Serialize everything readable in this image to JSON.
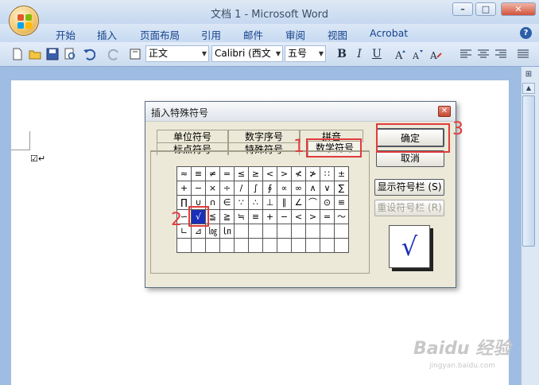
{
  "window": {
    "title": "文档 1 - Microsoft Word",
    "minimize": "–",
    "maximize": "□",
    "close": "✕"
  },
  "menu": {
    "items": [
      "开始",
      "插入",
      "页面布局",
      "引用",
      "邮件",
      "审阅",
      "视图",
      "Acrobat"
    ],
    "help": "?"
  },
  "toolbar": {
    "style": "正文",
    "font": "Calibri (西文",
    "size": "五号",
    "bold": "B",
    "italic": "I",
    "underline": "U"
  },
  "document": {
    "text": "☑↵"
  },
  "dialog": {
    "title": "插入特殊符号",
    "close": "✕",
    "tabs_back": [
      "单位符号",
      "数字序号",
      "拼音"
    ],
    "tabs_front": [
      "标点符号",
      "特殊符号",
      "数学符号"
    ],
    "grid": [
      [
        "≈",
        "≡",
        "≠",
        "=",
        "≤",
        "≥",
        "<",
        ">",
        "≮",
        "≯",
        "∷",
        "±"
      ],
      [
        "+",
        "−",
        "×",
        "÷",
        "/",
        "∫",
        "∮",
        "∝",
        "∞",
        "∧",
        "∨",
        "∑"
      ],
      [
        "∏",
        "∪",
        "∩",
        "∈",
        "∵",
        "∴",
        "⊥",
        "∥",
        "∠",
        "⌒",
        "⊙",
        "≌"
      ],
      [
        "∽",
        "√",
        "≦",
        "≧",
        "≒",
        "≡",
        "+",
        "−",
        "<",
        ">",
        "=",
        "～"
      ],
      [
        "∟",
        "⊿",
        "㏒",
        "㏑",
        "",
        "",
        "",
        "",
        "",
        "",
        "",
        ""
      ],
      [
        "",
        "",
        "",
        "",
        "",
        "",
        "",
        "",
        "",
        "",
        "",
        ""
      ]
    ],
    "selected": "√",
    "buttons": {
      "ok": "确定",
      "cancel": "取消",
      "show_bar": "显示符号栏 (S)",
      "reset_bar": "重设符号栏 (R)"
    },
    "preview": "√"
  },
  "annotations": {
    "n1": "1",
    "n2": "2",
    "n3": "3"
  },
  "watermark": {
    "brand": "Baidu 经验",
    "url": "jingyan.baidu.com"
  }
}
